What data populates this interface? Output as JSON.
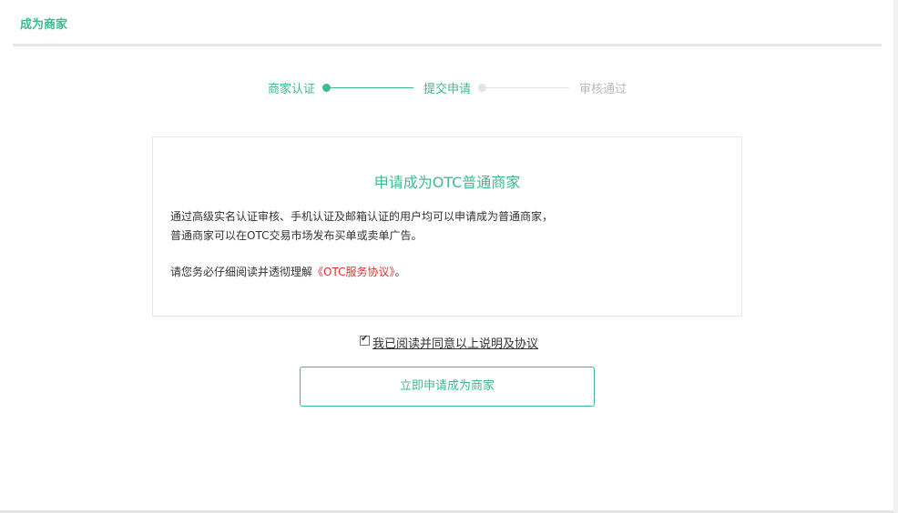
{
  "header": {
    "title": "成为商家"
  },
  "steps": [
    {
      "label": "商家认证",
      "state": "done"
    },
    {
      "label": "提交申请",
      "state": "current"
    },
    {
      "label": "审核通过",
      "state": "pending"
    }
  ],
  "card": {
    "title": "申请成为OTC普通商家",
    "line1": "通过高级实名认证审核、手机认证及邮箱认证的用户均可以申请成为普通商家，",
    "line2": "普通商家可以在OTC交易市场发布买单或卖单广告。",
    "notice_prefix": "请您务必仔细阅读并透彻理解",
    "agreement_link": "《OTC服务协议》",
    "notice_suffix": "。"
  },
  "agreement": {
    "checked": true,
    "checkmark": "✔",
    "label": "我已阅读并同意以上说明及协议"
  },
  "apply_button": {
    "label": "立即申请成为商家"
  },
  "colors": {
    "accent": "#3cbb8f",
    "link": "#e0312f",
    "muted": "#b9b9b9"
  }
}
